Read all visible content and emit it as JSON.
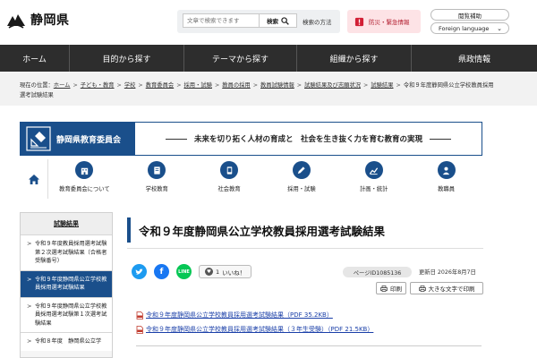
{
  "header": {
    "logo_text": "静岡県",
    "search_placeholder": "文章で検索できます",
    "search_button": "検索",
    "search_help": "検索の方法",
    "disaster_label": "防災・緊急情報",
    "assist_label": "閲覧補助",
    "language_label": "Foreign language"
  },
  "gnav": [
    "ホーム",
    "目的から探す",
    "テーマから探す",
    "組織から探す",
    "県政情報"
  ],
  "breadcrumb": {
    "prefix": "現在の位置：",
    "items": [
      "ホーム",
      "子ども・教育",
      "学校",
      "教育委員会",
      "採用・試験",
      "教員の採用",
      "教員試験情報",
      "試験結果及び志願状況",
      "試験結果"
    ],
    "current": "令和９年度静岡県公立学校教員採用選考試験結果"
  },
  "banner": {
    "title": "静岡県教育委員会",
    "slogan": "未来を切り拓く人材の育成と　社会を生き抜く力を育む教育の実現"
  },
  "catnav": [
    {
      "label": "教育委員会について",
      "icon": "building-icon"
    },
    {
      "label": "学校教育",
      "icon": "book-icon"
    },
    {
      "label": "社会教育",
      "icon": "tablet-icon"
    },
    {
      "label": "採用・試験",
      "icon": "pen-icon"
    },
    {
      "label": "計画・統計",
      "icon": "graph-icon"
    },
    {
      "label": "教職員",
      "icon": "people-icon"
    }
  ],
  "sidebar": {
    "heading": "試験結果",
    "items": [
      {
        "label": "令和９年度教員採用選考試験第２次選考試験結果（合格者受験番号）",
        "active": false
      },
      {
        "label": "令和９年度静岡県公立学校教員採用選考試験結果",
        "active": true
      },
      {
        "label": "令和９年度静岡県公立学校教員採用選考試験第１次選考試験結果",
        "active": false
      },
      {
        "label": "令和８年度　静岡県公立学",
        "active": false
      }
    ]
  },
  "main": {
    "title": "令和９年度静岡県公立学校教員採用選考試験結果",
    "like_label": "いいね！",
    "like_count": "1",
    "page_id": "ページID1085136",
    "updated": "更新日 2026年8月7日",
    "print_label": "印刷",
    "bigtext_label": "大きな文字で印刷",
    "pdf_links": [
      "令和９年度静岡県公立学校教員採用選考試験結果（PDF 35.2KB）",
      "令和９年度静岡県公立学校教員採用選考試験結果（３年生受験）（PDF 21.5KB）"
    ]
  },
  "colors": {
    "primary": "#1a4f8b",
    "nav_bg": "#2d2d2d",
    "disaster_bg": "#fde3e6",
    "disaster_text": "#b0182a",
    "link": "#1a3fa8"
  }
}
